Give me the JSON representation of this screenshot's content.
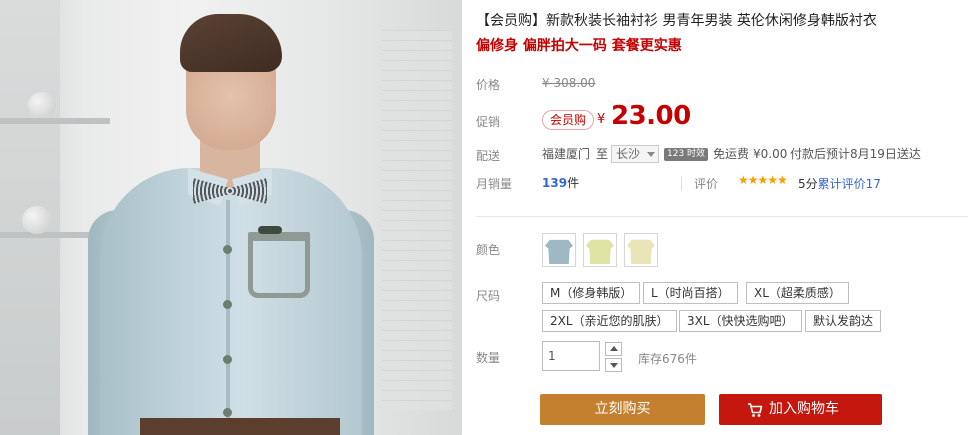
{
  "product": {
    "title": "【会员购】新款秋装长袖衬衫 男青年男装 英伦休闲修身韩版衬衣",
    "subtitle": "偏修身 偏胖拍大一码 套餐更实惠"
  },
  "price": {
    "label": "价格",
    "original": "¥ 308.00",
    "promo_label": "促销",
    "vip_badge": "会员购",
    "currency": "¥",
    "current": "23.00"
  },
  "shipping": {
    "label": "配送",
    "from": "福建厦门",
    "to_word": "至",
    "destination": "长沙",
    "days_badge": "123 时效",
    "free_shipping": "免运费",
    "fee": "¥0.00",
    "eta": "付款后预计8月19日送达"
  },
  "sales": {
    "label": "月销量",
    "count": "139",
    "unit": "件",
    "rating_label": "评价",
    "stars": "★★★★★",
    "score": "5分",
    "review_link": "累计评价17"
  },
  "colors": {
    "label": "颜色",
    "swatches": [
      "blue-shirt",
      "yellow-shirt",
      "cream-shirt"
    ]
  },
  "sizes": {
    "label": "尺码",
    "options": [
      "M（修身韩版）",
      "L（时尚百搭）",
      "XL（超柔质感）",
      "2XL（亲近您的肌肤）",
      "3XL（快快选购吧）",
      "默认发韵达"
    ]
  },
  "quantity": {
    "label": "数量",
    "value": "1",
    "stock": "库存676件"
  },
  "actions": {
    "buy_now": "立刻购买",
    "add_to_cart": "加入购物车"
  },
  "theme": {
    "price_red": "#c40000",
    "buy_orange": "#c5802f",
    "cart_red": "#c4170e",
    "link_blue": "#3366cc",
    "star_gold": "#f5a000"
  }
}
